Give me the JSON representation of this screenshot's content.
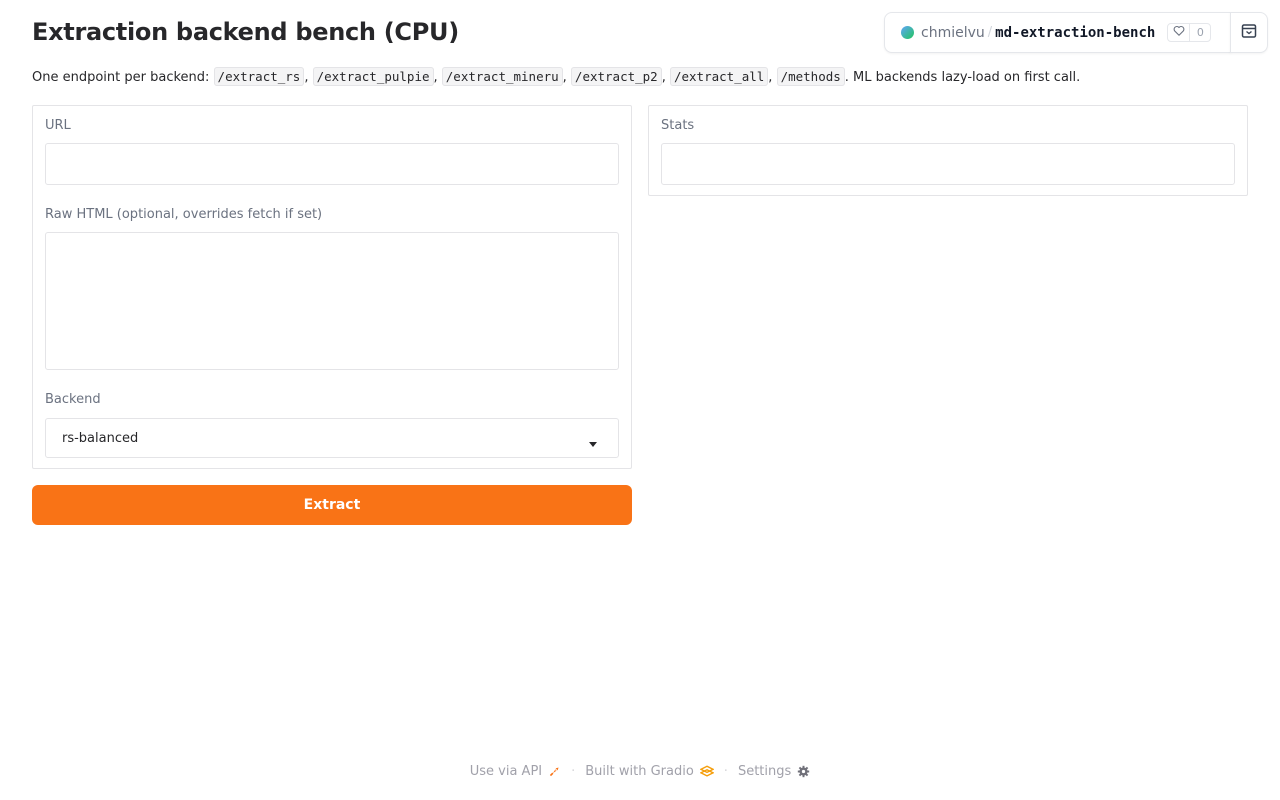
{
  "page": {
    "title": "Extraction backend bench (CPU)"
  },
  "description": {
    "prefix": "One endpoint per backend: ",
    "endpoints": [
      "/extract_rs",
      "/extract_pulpie",
      "/extract_mineru",
      "/extract_p2",
      "/extract_all",
      "/methods"
    ],
    "separator": ", ",
    "suffix": ". ML backends lazy-load on first call."
  },
  "space_badge": {
    "owner": "chmielvu",
    "separator": "/",
    "name": "md-extraction-bench",
    "likes": "0",
    "heart_icon": "heart-icon",
    "collapse_icon": "collapse-icon"
  },
  "form": {
    "url_label": "URL",
    "url_value": "",
    "raw_html_label": "Raw HTML (optional, overrides fetch if set)",
    "raw_html_value": "",
    "backend_label": "Backend",
    "backend_value": "rs-balanced"
  },
  "output": {
    "stats_label": "Stats",
    "stats_value": ""
  },
  "actions": {
    "extract_label": "Extract"
  },
  "footer": {
    "api_label": "Use via API",
    "built_label": "Built with Gradio",
    "settings_label": "Settings",
    "dot": "·"
  },
  "colors": {
    "accent": "#f97316"
  }
}
